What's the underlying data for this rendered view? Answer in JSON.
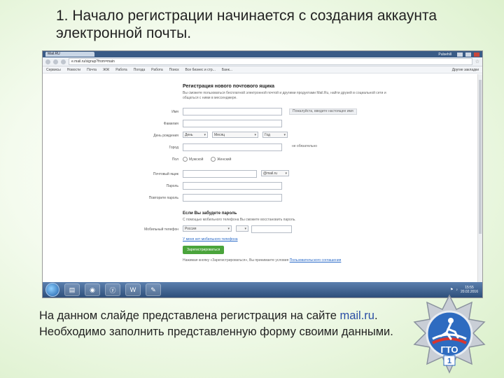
{
  "slide_title": "1. Начало регистрации начинается с создания аккаунта электронной почты.",
  "browser": {
    "tab_title": "Mail.RU",
    "app_label": "Pulsehill",
    "url": "e.mail.ru/signup?from=main",
    "bookmarks": [
      "Сервисы",
      "Новости",
      "Почта",
      "ЖЖ",
      "Работа",
      "Погода",
      "Работа",
      "Поиск",
      "Все бизнес и стр...",
      "Банк..."
    ],
    "other_bookmarks": "Другие закладки"
  },
  "form": {
    "heading": "Регистрация нового почтового ящика",
    "intro": "Вы сможете пользоваться бесплатной электронной почтой и другими продуктами Mail.Ru, найти друзей в социальной сети и общаться с ними в мессенджере.",
    "labels": {
      "name": "Имя",
      "surname": "Фамилия",
      "birthday": "День рождения",
      "city": "Город",
      "gender": "Пол",
      "mailbox": "Почтовый ящик",
      "password": "Пароль",
      "repeat_password": "Повторите пароль",
      "phone": "Мобильный телефон"
    },
    "name_hint": "Пожалуйста, введите настоящее имя",
    "birth_day": "День",
    "birth_month": "Месяц",
    "birth_year": "Год",
    "city_hint": "не обязательно",
    "gender_male": "Мужской",
    "gender_female": "Женский",
    "domain": "@mail.ru",
    "forgot_heading": "Если Вы забудете пароль",
    "forgot_text": "С помощью мобильного телефона Вы сможете восстановить пароль.",
    "country": "Россия",
    "no_phone_link": "У меня нет мобильного телефона",
    "submit": "Зарегистрироваться",
    "footer_note": "Нажимая кнопку «Зарегистрироваться», Вы принимаете условия",
    "footer_link": "Пользовательского соглашения"
  },
  "taskbar": {
    "apps": [
      "folder",
      "chrome",
      "yandex",
      "word",
      "paint"
    ],
    "time": "15:55",
    "date": "20.02.2016"
  },
  "caption": {
    "part1": "На данном слайде представлена регистрация на сайте ",
    "site": "mail.ru",
    "part2": ". Необходимо заполнить представленную форму своими данными."
  },
  "badge": {
    "text": "ГТО",
    "number": "1"
  },
  "colors": {
    "submit_green": "#4aa43b",
    "link_blue": "#2a6ac8",
    "badge_blue": "#2e6bc0"
  }
}
